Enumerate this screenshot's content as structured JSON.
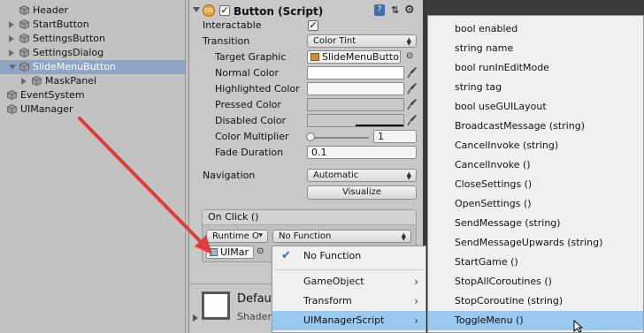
{
  "hierarchy": {
    "items": [
      {
        "label": "Header",
        "indent": 1,
        "arrow": "none",
        "selected": false
      },
      {
        "label": "StartButton",
        "indent": 1,
        "arrow": "right",
        "selected": false
      },
      {
        "label": "SettingsButton",
        "indent": 1,
        "arrow": "right",
        "selected": false
      },
      {
        "label": "SettingsDialog",
        "indent": 1,
        "arrow": "right",
        "selected": false
      },
      {
        "label": "SlideMenuButton",
        "indent": 1,
        "arrow": "down",
        "selected": true
      },
      {
        "label": "MaskPanel",
        "indent": 2,
        "arrow": "right",
        "selected": false
      },
      {
        "label": "EventSystem",
        "indent": 0,
        "arrow": "none",
        "selected": false
      },
      {
        "label": "UIManager",
        "indent": 0,
        "arrow": "none",
        "selected": false
      }
    ]
  },
  "inspector": {
    "component_title": "Button (Script)",
    "interactable_label": "Interactable",
    "interactable_checked": "✓",
    "transition_label": "Transition",
    "transition_value": "Color Tint",
    "target_graphic_label": "Target Graphic",
    "target_graphic_value": "SlideMenuButto",
    "normal_color_label": "Normal Color",
    "highlighted_color_label": "Highlighted Color",
    "pressed_color_label": "Pressed Color",
    "disabled_color_label": "Disabled Color",
    "color_multiplier_label": "Color Multiplier",
    "color_multiplier_value": "1",
    "color_multiplier_fraction": 0.0,
    "fade_duration_label": "Fade Duration",
    "fade_duration_value": "0.1",
    "navigation_label": "Navigation",
    "navigation_value": "Automatic",
    "visualize_label": "Visualize",
    "onclick_label": "On Click ()",
    "runtime_value": "Runtime O",
    "function_value": "No Function",
    "object_value": "UIMar",
    "material_label": "Defaul",
    "shader_label": "Shader"
  },
  "context_menu": {
    "items": [
      {
        "label": "No Function",
        "checked": true,
        "submenu": false,
        "highlighted": false
      },
      {
        "label": "GameObject",
        "checked": false,
        "submenu": true,
        "highlighted": false
      },
      {
        "label": "Transform",
        "checked": false,
        "submenu": true,
        "highlighted": false
      },
      {
        "label": "UIManagerScript",
        "checked": false,
        "submenu": true,
        "highlighted": true
      }
    ]
  },
  "method_menu": {
    "items": [
      "bool enabled",
      "string name",
      "bool runInEditMode",
      "string tag",
      "bool useGUILayout",
      "BroadcastMessage (string)",
      "CancelInvoke (string)",
      "CancelInvoke ()",
      "CloseSettings ()",
      "OpenSettings ()",
      "SendMessage (string)",
      "SendMessageUpwards (string)",
      "StartGame ()",
      "StopAllCoroutines ()",
      "StopCoroutine (string)",
      "ToggleMenu ()"
    ],
    "highlighted": "ToggleMenu ()"
  },
  "colors": {
    "annotation_arrow": "#e03c3c",
    "menu_highlight": "#99c9ef",
    "hierarchy_selected": "#8ea6c3"
  },
  "icons": [
    "gameobject-cube-icon",
    "script-icon",
    "help-icon",
    "settings-gear-icon",
    "eyedropper-icon",
    "checkmark-icon",
    "submenu-arrow-icon",
    "mouse-cursor-icon"
  ]
}
